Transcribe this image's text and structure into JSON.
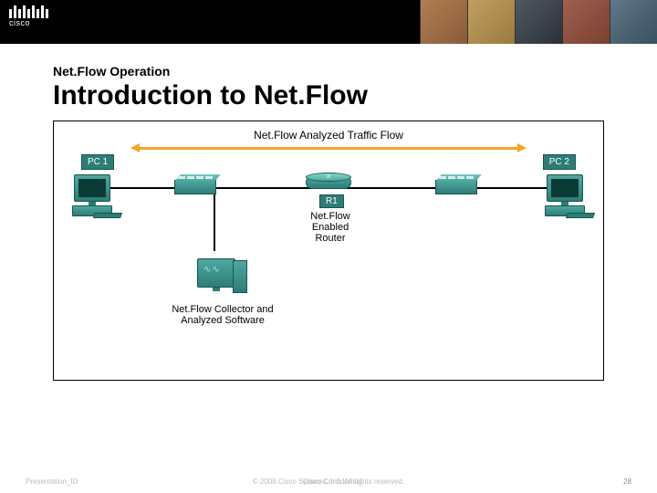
{
  "header": {
    "brand": "cisco"
  },
  "section": {
    "label": "Net.Flow Operation",
    "title": "Introduction to Net.Flow"
  },
  "diagram": {
    "flow_label": "Net.Flow Analyzed Traffic Flow",
    "pc1_label": "PC 1",
    "pc2_label": "PC 2",
    "router_label": "R1",
    "router_desc": "Net.Flow Enabled Router",
    "collector_desc": "Net.Flow Collector and Analyzed Software"
  },
  "footer": {
    "left": "Presentation_ID",
    "center": "© 2008 Cisco Systems, Inc. All rights reserved.",
    "right": "Cisco Confidential",
    "page": "28"
  }
}
